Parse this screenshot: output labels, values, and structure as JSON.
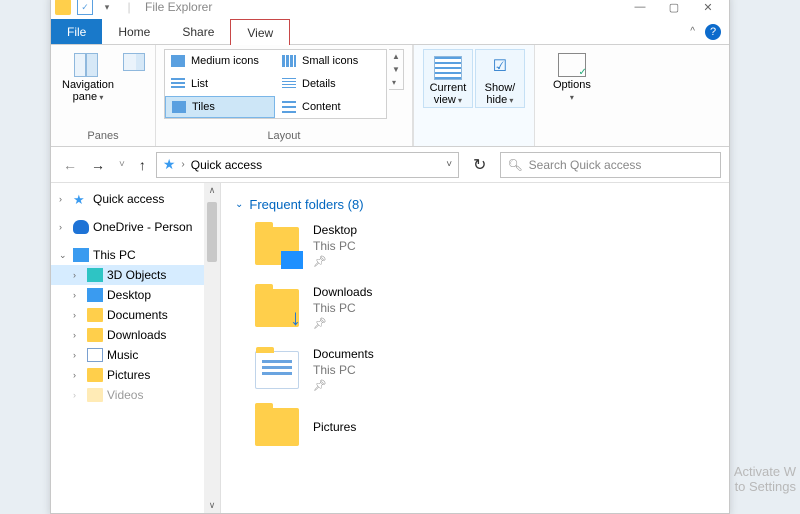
{
  "window": {
    "title": "File Explorer"
  },
  "tabs": {
    "file": "File",
    "home": "Home",
    "share": "Share",
    "view": "View"
  },
  "ribbon": {
    "panes": {
      "nav": "Navigation pane",
      "group": "Panes"
    },
    "layout": {
      "medium": "Medium icons",
      "small": "Small icons",
      "list": "List",
      "details": "Details",
      "tiles": "Tiles",
      "content": "Content",
      "group": "Layout"
    },
    "currentview": "Current view",
    "showhide": "Show/ hide",
    "options": "Options"
  },
  "address": {
    "location": "Quick access",
    "search_placeholder": "Search Quick access"
  },
  "tree": {
    "quick": "Quick access",
    "onedrive": "OneDrive - Person",
    "thispc": "This PC",
    "items": {
      "obj3d": "3D Objects",
      "desktop": "Desktop",
      "documents": "Documents",
      "downloads": "Downloads",
      "music": "Music",
      "pictures": "Pictures",
      "videos": "Videos"
    }
  },
  "main": {
    "section": "Frequent folders (8)",
    "tiles": [
      {
        "name": "Desktop",
        "loc": "This PC"
      },
      {
        "name": "Downloads",
        "loc": "This PC"
      },
      {
        "name": "Documents",
        "loc": "This PC"
      },
      {
        "name": "Pictures",
        "loc": ""
      }
    ]
  },
  "watermark": {
    "l1": "Activate W",
    "l2": "to Settings"
  }
}
